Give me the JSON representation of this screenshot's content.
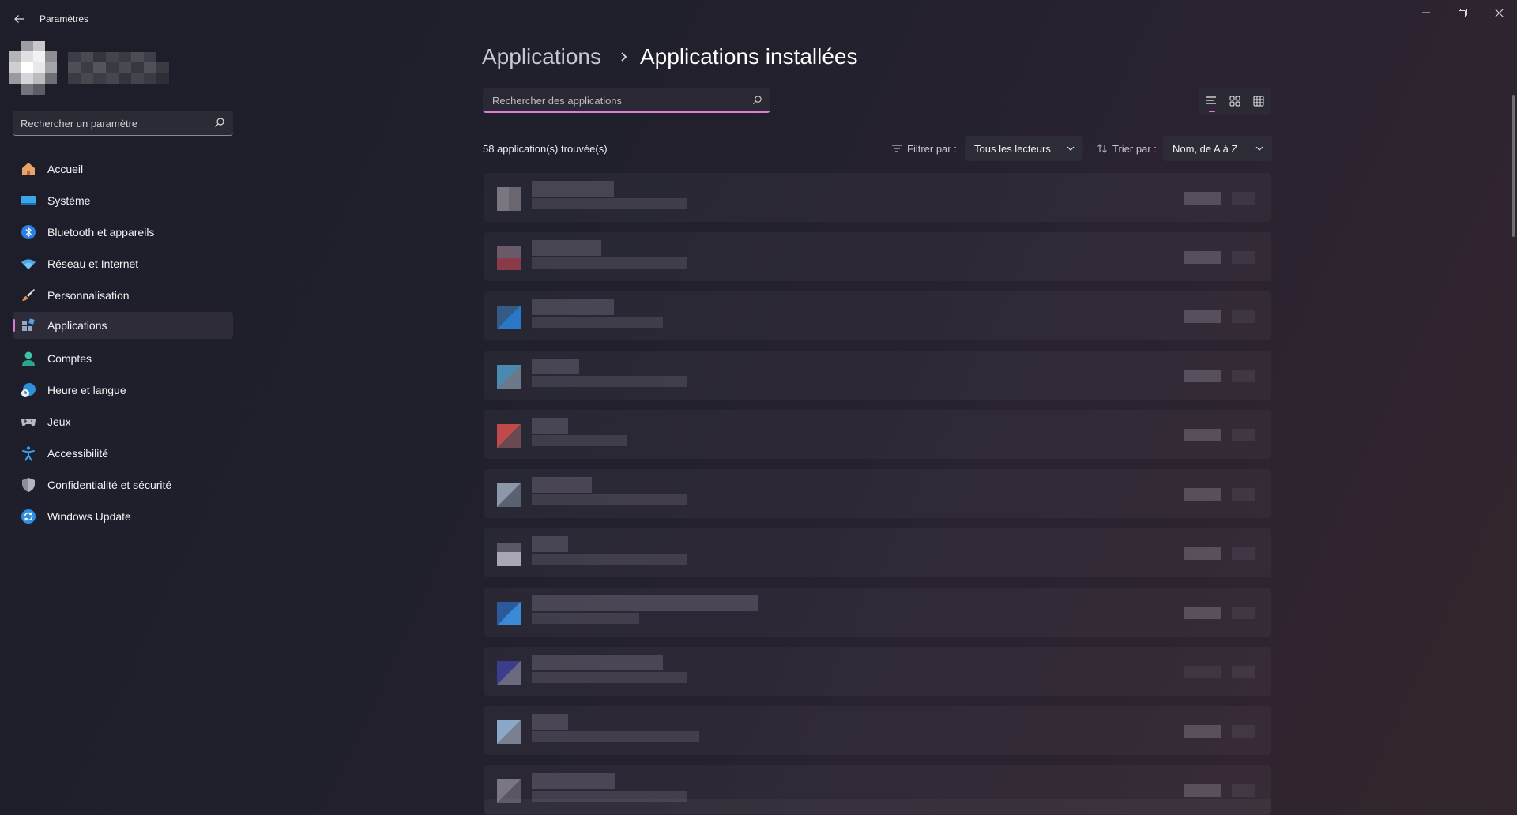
{
  "window": {
    "title": "Paramètres",
    "controls": [
      "minimize-icon",
      "restore-icon",
      "close-icon"
    ]
  },
  "sidebar": {
    "search_placeholder": "Rechercher un paramètre",
    "items": [
      {
        "label": "Accueil",
        "icon": "home-icon"
      },
      {
        "label": "Système",
        "icon": "system-icon"
      },
      {
        "label": "Bluetooth et appareils",
        "icon": "bluetooth-icon"
      },
      {
        "label": "Réseau et Internet",
        "icon": "wifi-icon"
      },
      {
        "label": "Personnalisation",
        "icon": "brush-icon"
      },
      {
        "label": "Applications",
        "icon": "apps-icon",
        "active": true
      },
      {
        "label": "Comptes",
        "icon": "account-icon"
      },
      {
        "label": "Heure et langue",
        "icon": "clock-globe-icon"
      },
      {
        "label": "Jeux",
        "icon": "gamepad-icon"
      },
      {
        "label": "Accessibilité",
        "icon": "accessibility-icon"
      },
      {
        "label": "Confidentialité et sécurité",
        "icon": "shield-icon"
      },
      {
        "label": "Windows Update",
        "icon": "update-icon"
      }
    ]
  },
  "main": {
    "breadcrumb": {
      "parent": "Applications",
      "current": "Applications installées"
    },
    "search_placeholder": "Rechercher des applications",
    "view_modes": [
      "list-view-icon",
      "grid-view-icon",
      "table-view-icon"
    ],
    "count_text": "58 application(s) trouvée(s)",
    "filter": {
      "label": "Filtrer par :",
      "value": "Tous les lecteurs"
    },
    "sort": {
      "label": "Trier par :",
      "value": "Nom, de A à Z"
    }
  },
  "colors": {
    "accent": "#d880d9",
    "background": "#20202c"
  }
}
